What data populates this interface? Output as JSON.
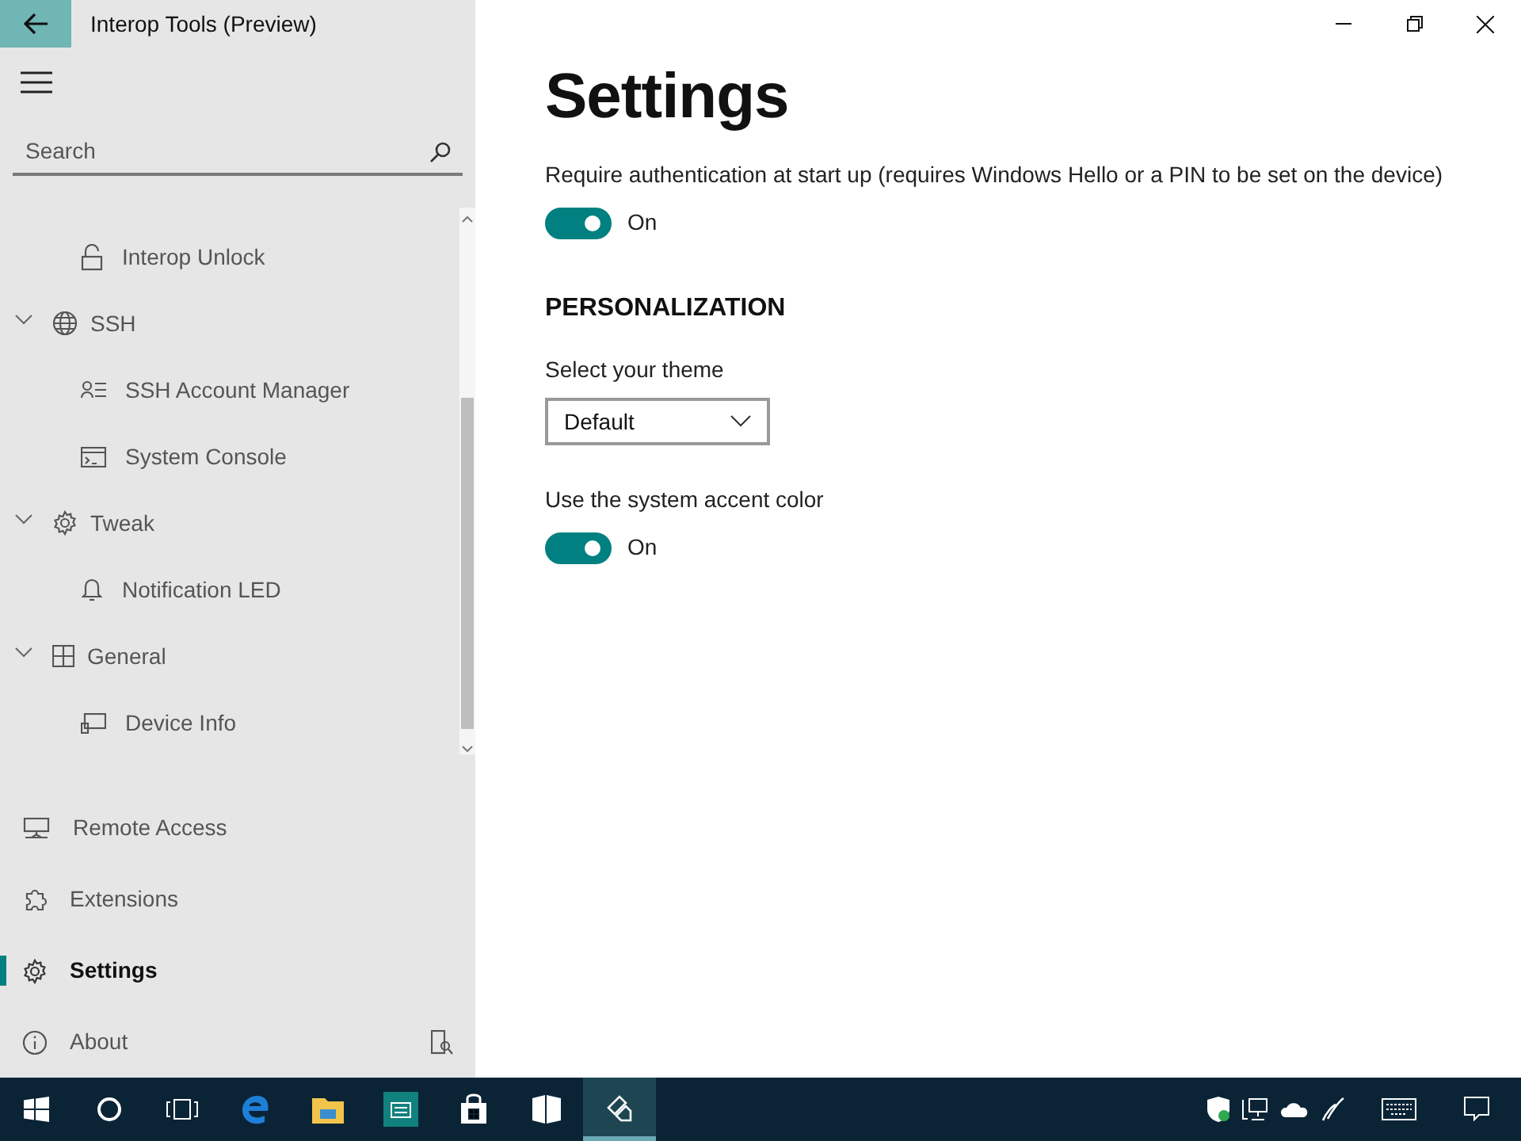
{
  "window": {
    "title": "Interop Tools (Preview)"
  },
  "sidebar": {
    "search": {
      "placeholder": "Search"
    },
    "tree": [
      {
        "children": [
          {
            "label": "Interop Unlock"
          }
        ]
      },
      {
        "label": "SSH",
        "expanded": true,
        "children": [
          {
            "label": "SSH Account Manager"
          },
          {
            "label": "System Console"
          }
        ]
      },
      {
        "label": "Tweak",
        "expanded": true,
        "children": [
          {
            "label": "Notification LED"
          }
        ]
      },
      {
        "label": "General",
        "expanded": true,
        "children": [
          {
            "label": "Device Info"
          }
        ]
      }
    ],
    "footer_items": [
      {
        "label": "Remote Access",
        "selected": false
      },
      {
        "label": "Extensions",
        "selected": false
      },
      {
        "label": "Settings",
        "selected": true
      },
      {
        "label": "About",
        "selected": false
      }
    ]
  },
  "page": {
    "title": "Settings",
    "settings": [
      {
        "kind": "toggle",
        "label": "Require authentication at start up (requires Windows Hello or a PIN to be set on the device)",
        "on": true,
        "state_text": "On"
      },
      {
        "kind": "heading",
        "label": "PERSONALIZATION"
      },
      {
        "kind": "dropdown",
        "label": "Select your theme",
        "value": "Default"
      },
      {
        "kind": "toggle",
        "label": "Use the system accent color",
        "on": true,
        "state_text": "On"
      }
    ]
  },
  "taskbar": {
    "apps": [
      {
        "selected": false
      },
      {
        "selected": false
      },
      {
        "selected": false
      },
      {
        "selected": false
      },
      {
        "selected": false
      },
      {
        "selected": true
      }
    ]
  }
}
